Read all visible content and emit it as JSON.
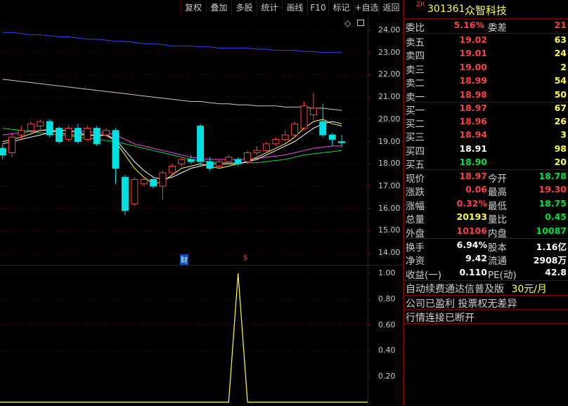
{
  "toolbar": {
    "buttons": [
      "复权",
      "叠加",
      "多股",
      "统计",
      "画线",
      "F10",
      "标记",
      "+自选",
      "返回"
    ]
  },
  "header": {
    "tag": "ZR",
    "code": "301361",
    "name": "众智科技"
  },
  "order_ratio": {
    "label1": "委比",
    "value1": "5.16%",
    "label2": "委差",
    "value2": "21"
  },
  "asks": [
    {
      "label": "卖五",
      "price": "19.02",
      "vol": "63"
    },
    {
      "label": "卖四",
      "price": "19.01",
      "vol": "24"
    },
    {
      "label": "卖三",
      "price": "19.00",
      "vol": "2"
    },
    {
      "label": "卖二",
      "price": "18.99",
      "vol": "54"
    },
    {
      "label": "卖一",
      "price": "18.98",
      "vol": "50"
    }
  ],
  "bids": [
    {
      "label": "买一",
      "price": "18.97",
      "vol": "67"
    },
    {
      "label": "买二",
      "price": "18.96",
      "vol": "26"
    },
    {
      "label": "买三",
      "price": "18.94",
      "vol": "3"
    },
    {
      "label": "买四",
      "price": "18.91",
      "vol": "98"
    },
    {
      "label": "买五",
      "price": "18.90",
      "vol": "20"
    }
  ],
  "quote": [
    {
      "l1": "现价",
      "v1": "18.97",
      "l2": "今开",
      "v2": "18.78"
    },
    {
      "l1": "涨跌",
      "v1": "0.06",
      "l2": "最高",
      "v2": "19.30"
    },
    {
      "l1": "涨幅",
      "v1": "0.32%",
      "l2": "最低",
      "v2": "18.75"
    },
    {
      "l1": "总量",
      "v1": "20193",
      "l2": "量比",
      "v2": "0.45"
    },
    {
      "l1": "外盘",
      "v1": "10106",
      "l2": "内盘",
      "v2": "10087"
    }
  ],
  "fundamentals": [
    {
      "l1": "换手",
      "v1": "6.94%",
      "l2": "股本",
      "v2": "1.16亿"
    },
    {
      "l1": "净资",
      "v1": "9.42",
      "l2": "流通",
      "v2": "2908万"
    },
    {
      "l1": "收益(一)",
      "v1": "0.110",
      "l2": "PE(动)",
      "v2": "42.8"
    }
  ],
  "notices": {
    "line1_text": "自动续费通达信普及版",
    "line1_price": "30元/月",
    "line2": "公司已盈利 投票权无差异",
    "line3": "行情连接已断开"
  },
  "markers": {
    "cai": "财",
    "dollar": "$",
    "diamond": "◇"
  },
  "colors": {
    "up": "#ff4040",
    "down": "#00e0e0",
    "bg": "#000000",
    "grid": "#7a0000"
  },
  "chart_data": [
    {
      "type": "candlestick",
      "yticks": [
        "24.00",
        "23.00",
        "22.00",
        "21.00",
        "20.00",
        "19.00",
        "18.00",
        "17.00",
        "16.00",
        "15.00",
        "14.00"
      ],
      "ylim": [
        13.5,
        24.6
      ],
      "candles": [
        {
          "o": 18.7,
          "c": 18.4,
          "h": 18.9,
          "l": 18.2
        },
        {
          "o": 18.5,
          "c": 19.2,
          "h": 19.4,
          "l": 18.3
        },
        {
          "o": 19.3,
          "c": 19.5,
          "h": 19.7,
          "l": 19.1
        },
        {
          "o": 19.5,
          "c": 19.8,
          "h": 19.9,
          "l": 19.3
        },
        {
          "o": 19.7,
          "c": 19.9,
          "h": 20.0,
          "l": 19.5
        },
        {
          "o": 19.9,
          "c": 19.3,
          "h": 20.0,
          "l": 19.2
        },
        {
          "o": 19.6,
          "c": 19.0,
          "h": 19.7,
          "l": 18.9
        },
        {
          "o": 19.1,
          "c": 19.6,
          "h": 19.7,
          "l": 19.0
        },
        {
          "o": 19.6,
          "c": 19.0,
          "h": 19.8,
          "l": 18.9
        },
        {
          "o": 19.1,
          "c": 19.6,
          "h": 19.7,
          "l": 19.0
        },
        {
          "o": 19.6,
          "c": 18.9,
          "h": 19.7,
          "l": 18.8
        },
        {
          "o": 19.3,
          "c": 19.5,
          "h": 19.6,
          "l": 19.2
        },
        {
          "o": 19.5,
          "c": 17.8,
          "h": 19.6,
          "l": 17.1
        },
        {
          "o": 17.4,
          "c": 15.9,
          "h": 17.5,
          "l": 15.7
        },
        {
          "o": 16.2,
          "c": 17.3,
          "h": 17.4,
          "l": 16.1
        },
        {
          "o": 17.1,
          "c": 17.3,
          "h": 17.4,
          "l": 17.0
        },
        {
          "o": 17.3,
          "c": 17.0,
          "h": 17.4,
          "l": 16.9
        },
        {
          "o": 17.0,
          "c": 17.6,
          "h": 17.7,
          "l": 16.4
        },
        {
          "o": 17.6,
          "c": 17.9,
          "h": 18.0,
          "l": 17.5
        },
        {
          "o": 18.0,
          "c": 18.2,
          "h": 18.3,
          "l": 17.9
        },
        {
          "o": 18.2,
          "c": 18.1,
          "h": 18.4,
          "l": 18.0
        },
        {
          "o": 19.7,
          "c": 18.1,
          "h": 19.8,
          "l": 17.9
        },
        {
          "o": 18.1,
          "c": 17.8,
          "h": 18.3,
          "l": 17.7
        },
        {
          "o": 17.9,
          "c": 18.1,
          "h": 18.2,
          "l": 17.8
        },
        {
          "o": 18.1,
          "c": 18.3,
          "h": 18.4,
          "l": 18.0
        },
        {
          "o": 18.2,
          "c": 18.0,
          "h": 18.3,
          "l": 17.9
        },
        {
          "o": 18.1,
          "c": 18.5,
          "h": 18.6,
          "l": 18.0
        },
        {
          "o": 18.5,
          "c": 18.6,
          "h": 18.8,
          "l": 18.4
        },
        {
          "o": 18.6,
          "c": 18.9,
          "h": 19.0,
          "l": 18.5
        },
        {
          "o": 18.9,
          "c": 19.1,
          "h": 19.2,
          "l": 18.8
        },
        {
          "o": 19.1,
          "c": 19.3,
          "h": 19.5,
          "l": 19.0
        },
        {
          "o": 19.3,
          "c": 19.8,
          "h": 19.9,
          "l": 19.2
        },
        {
          "o": 19.6,
          "c": 20.6,
          "h": 20.8,
          "l": 19.5
        },
        {
          "o": 20.2,
          "c": 20.5,
          "h": 21.2,
          "l": 20.0
        },
        {
          "o": 19.9,
          "c": 19.3,
          "h": 20.7,
          "l": 19.2
        },
        {
          "o": 19.3,
          "c": 19.1,
          "h": 19.4,
          "l": 18.8
        },
        {
          "o": 19.0,
          "c": 18.95,
          "h": 19.3,
          "l": 18.75
        }
      ],
      "ma_lines": [
        {
          "color": "#3040ff",
          "points": [
            23.9,
            23.9,
            23.85,
            23.8,
            23.8,
            23.75,
            23.7,
            23.7,
            23.65,
            23.6,
            23.6,
            23.55,
            23.5,
            23.5,
            23.45,
            23.4,
            23.4,
            23.35,
            23.3,
            23.3,
            23.3,
            23.25,
            23.25,
            23.2,
            23.2,
            23.2,
            23.2,
            23.15,
            23.15,
            23.1,
            23.1,
            23.1,
            23.05,
            23.05,
            23.0,
            23.0,
            23.0
          ]
        },
        {
          "color": "#c8c8c8",
          "points": [
            21.8,
            21.75,
            21.7,
            21.65,
            21.6,
            21.55,
            21.5,
            21.45,
            21.4,
            21.35,
            21.3,
            21.25,
            21.2,
            21.15,
            21.1,
            21.05,
            21.0,
            20.95,
            20.9,
            20.85,
            20.8,
            20.8,
            20.75,
            20.7,
            20.7,
            20.65,
            20.65,
            20.6,
            20.6,
            20.6,
            20.55,
            20.55,
            20.55,
            20.5,
            20.5,
            20.45,
            20.4
          ]
        },
        {
          "color": "#ff40ff",
          "points": [
            19.3,
            19.35,
            19.4,
            19.45,
            19.5,
            19.5,
            19.5,
            19.5,
            19.45,
            19.45,
            19.4,
            19.4,
            19.3,
            19.1,
            18.9,
            18.8,
            18.7,
            18.6,
            18.5,
            18.4,
            18.3,
            18.25,
            18.2,
            18.2,
            18.2,
            18.2,
            18.2,
            18.25,
            18.3,
            18.35,
            18.4,
            18.5,
            18.6,
            18.7,
            18.75,
            18.8,
            18.8
          ]
        },
        {
          "color": "#00e040",
          "points": [
            19.6,
            19.55,
            19.5,
            19.45,
            19.4,
            19.35,
            19.3,
            19.25,
            19.2,
            19.15,
            19.1,
            19.05,
            19.0,
            18.9,
            18.8,
            18.7,
            18.6,
            18.5,
            18.4,
            18.3,
            18.2,
            18.15,
            18.1,
            18.05,
            18.05,
            18.05,
            18.05,
            18.05,
            18.1,
            18.15,
            18.2,
            18.3,
            18.4,
            18.45,
            18.5,
            18.55,
            18.6
          ]
        },
        {
          "color": "#ffff40",
          "points": [
            19.0,
            19.1,
            19.2,
            19.35,
            19.5,
            19.55,
            19.4,
            19.3,
            19.3,
            19.3,
            19.25,
            19.3,
            19.0,
            18.4,
            17.8,
            17.4,
            17.1,
            17.2,
            17.5,
            17.8,
            17.9,
            18.0,
            17.9,
            17.8,
            17.9,
            18.0,
            18.1,
            18.3,
            18.5,
            18.7,
            18.9,
            19.2,
            19.6,
            19.9,
            20.0,
            19.8,
            19.7
          ]
        },
        {
          "color": "#ffffff",
          "points": [
            18.9,
            19.0,
            19.1,
            19.2,
            19.3,
            19.4,
            19.5,
            19.5,
            19.4,
            19.3,
            19.3,
            19.3,
            19.1,
            18.6,
            18.1,
            17.7,
            17.4,
            17.3,
            17.4,
            17.6,
            17.8,
            17.9,
            18.0,
            18.0,
            18.0,
            18.0,
            18.1,
            18.2,
            18.4,
            18.6,
            18.8,
            19.0,
            19.3,
            19.6,
            19.8,
            19.9,
            19.8
          ]
        }
      ]
    },
    {
      "type": "line",
      "yticks": [
        "1.00",
        "0.80",
        "0.60",
        "0.40",
        "0.20"
      ],
      "ylim": [
        -0.03,
        1.05
      ],
      "values": [
        0,
        0,
        0,
        0,
        0,
        0,
        0,
        0,
        0,
        0,
        0,
        0,
        0,
        0,
        0,
        0,
        0,
        0,
        0,
        0,
        0,
        0,
        0,
        0,
        0,
        1,
        0,
        0,
        0,
        0,
        0,
        0,
        0,
        0,
        0,
        0,
        0
      ]
    }
  ]
}
